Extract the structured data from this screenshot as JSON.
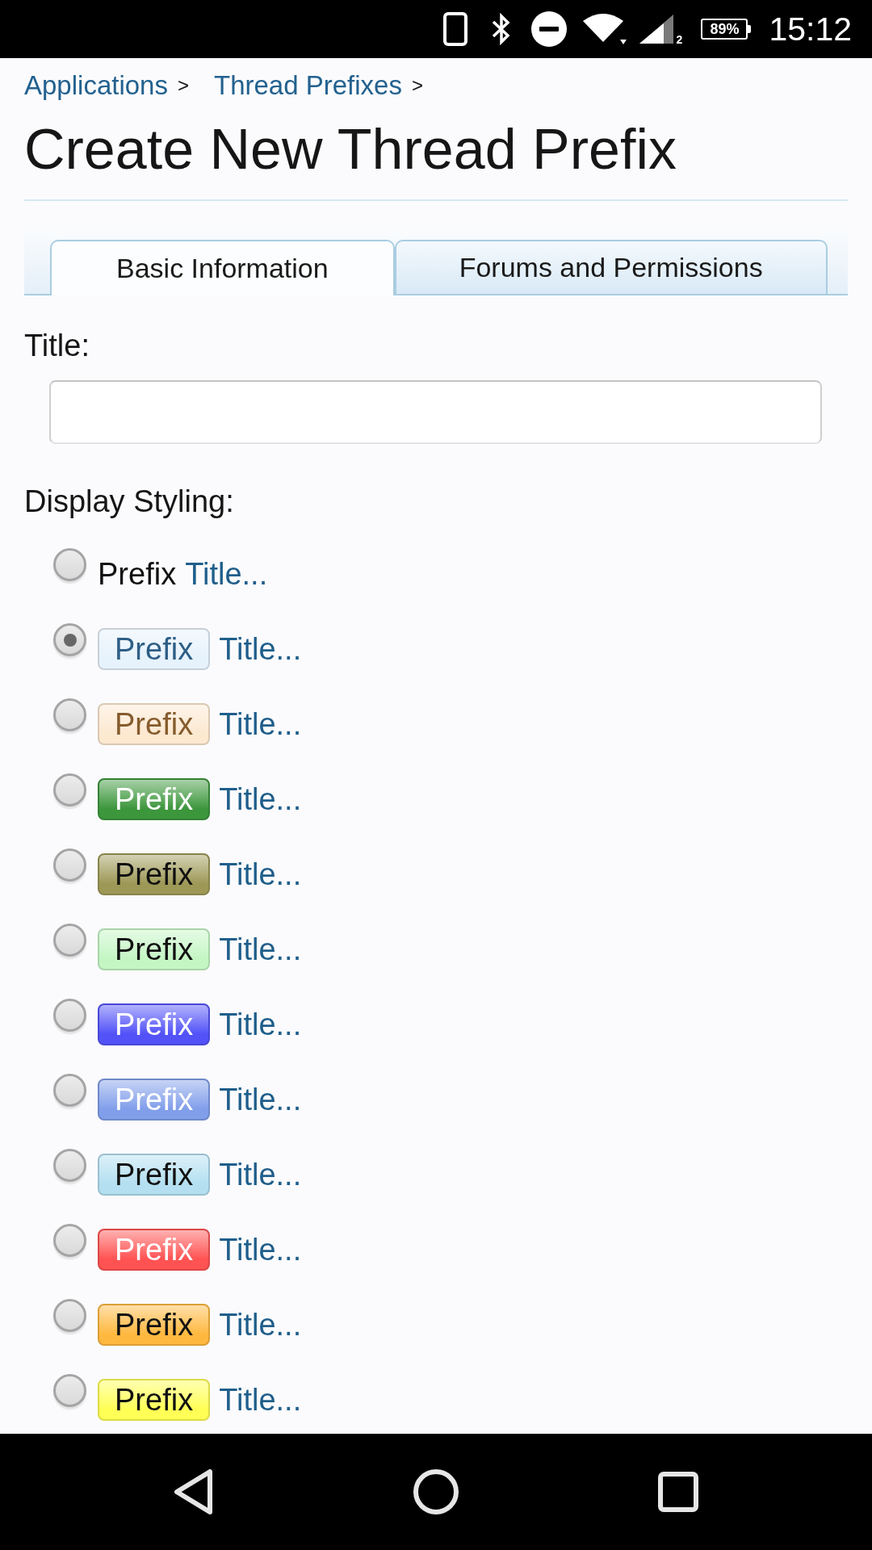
{
  "status_bar": {
    "signal_label": "2",
    "battery": "89%",
    "time": "15:12"
  },
  "breadcrumbs": [
    {
      "label": "Applications",
      "separator": ">"
    },
    {
      "label": "Thread Prefixes",
      "separator": ">"
    }
  ],
  "heading": "Create New Thread Prefix",
  "tabs": [
    {
      "label": "Basic Information",
      "selected": true
    },
    {
      "label": "Forums and Permissions",
      "selected": false
    }
  ],
  "title_field": {
    "label": "Title:"
  },
  "display_styling": {
    "label": "Display Styling:",
    "options": [
      {
        "kind": "plain",
        "prefix": "Prefix",
        "title": "Title...",
        "selected": false
      },
      {
        "kind": "tinted",
        "prefix": "Prefix",
        "title": "Title...",
        "selected": true,
        "color": "#e6f2fc"
      },
      {
        "kind": "tinted",
        "prefix": "Prefix",
        "title": "Title...",
        "selected": false,
        "color": "#fde8d0"
      },
      {
        "kind": "solid",
        "prefix": "Prefix",
        "title": "Title...",
        "selected": false,
        "color": "#3c963c"
      },
      {
        "kind": "pale",
        "prefix": "Prefix",
        "title": "Title...",
        "selected": false,
        "color": "#9d9856"
      },
      {
        "kind": "pale",
        "prefix": "Prefix",
        "title": "Title...",
        "selected": false,
        "color": "#c4f6c4"
      },
      {
        "kind": "solid",
        "prefix": "Prefix",
        "title": "Title...",
        "selected": false,
        "color": "#5252f8"
      },
      {
        "kind": "solid",
        "prefix": "Prefix",
        "title": "Title...",
        "selected": false,
        "color": "#819eea"
      },
      {
        "kind": "pale",
        "prefix": "Prefix",
        "title": "Title...",
        "selected": false,
        "color": "#b3dff1"
      },
      {
        "kind": "solid",
        "prefix": "Prefix",
        "title": "Title...",
        "selected": false,
        "color": "#ff5252"
      },
      {
        "kind": "pale",
        "prefix": "Prefix",
        "title": "Title...",
        "selected": false,
        "color": "#ffb83f"
      },
      {
        "kind": "pale",
        "prefix": "Prefix",
        "title": "Title...",
        "selected": false,
        "color": "#ffff55"
      }
    ]
  }
}
